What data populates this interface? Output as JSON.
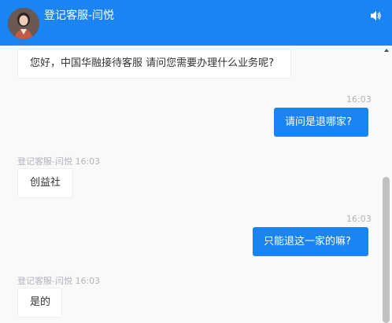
{
  "header": {
    "title": "登记客服-闫悦",
    "icons": {
      "avatar": "agent-avatar",
      "speaker": "speaker-icon"
    },
    "accent_color": "#1a84f3"
  },
  "messages": [
    {
      "side": "in",
      "sender_line": "",
      "text": "您好，中国华融接待客服 请问您需要办理什么业务呢?"
    },
    {
      "side": "out",
      "time": "16:03",
      "text": "请问是退哪家?"
    },
    {
      "side": "in",
      "sender_line": "登记客服-闫悦 16:03",
      "text": "创益社"
    },
    {
      "side": "out",
      "time": "16:03",
      "text": "只能退这一家的嘛?"
    },
    {
      "side": "in",
      "sender_line": "登记客服-闫悦 16:03",
      "text": "是的"
    }
  ]
}
